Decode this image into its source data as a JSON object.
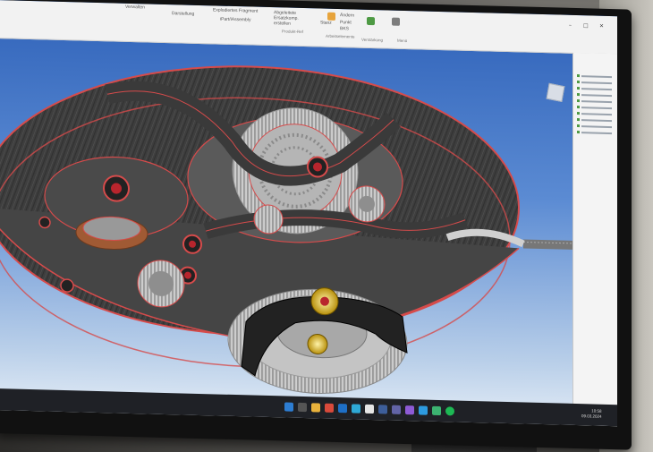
{
  "ribbon": {
    "items": [
      "Verwalten",
      "Darstellung",
      "Explodiertes Fragment",
      "iPart/iAssembly",
      "Abgeleitete Ersatzkomp. erstellen",
      "Produkt-Ref",
      "Stanz",
      "Ändern",
      "Punkt",
      "BKS",
      "Arbeitselemente",
      "Verstärkung",
      "Menü"
    ]
  },
  "taskbar": {
    "icons": [
      "start-icon",
      "search-icon",
      "explorer-icon",
      "browser-icon",
      "mail-icon",
      "edge-icon",
      "chrome-icon",
      "inventor-icon",
      "teams-icon",
      "vs-icon",
      "code-icon",
      "app-icon",
      "spotify-icon"
    ],
    "time": "10:58",
    "date": "09.03.2024"
  },
  "colors": {
    "accent": "#d64b4b",
    "gear_metal": "#c8c8c8",
    "plate": "#3b3b3b",
    "jewel": "#b8252d",
    "bezel": "#111111"
  }
}
